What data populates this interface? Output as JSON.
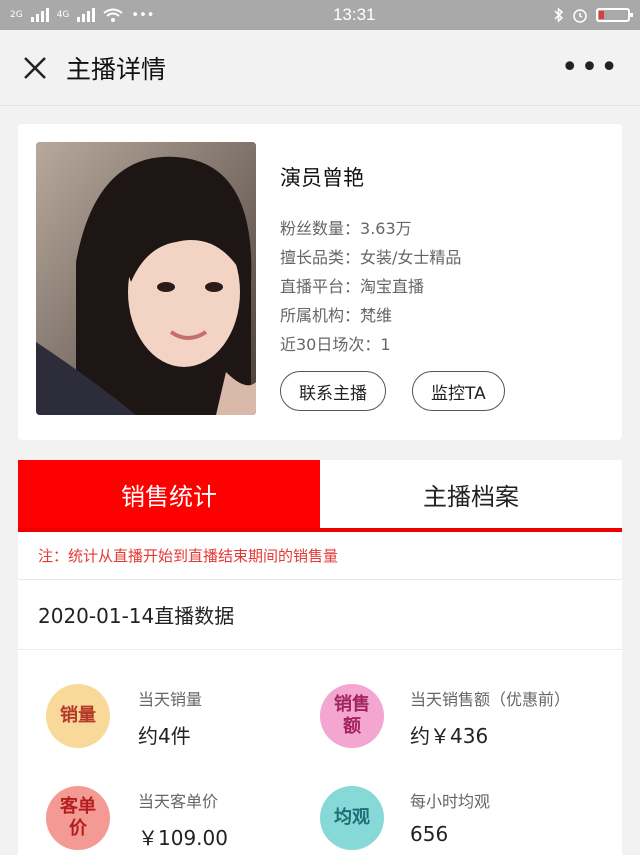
{
  "status": {
    "signal1": "2G",
    "signal2": "4G",
    "more": "•••",
    "time": "13:31"
  },
  "nav": {
    "title": "主播详情",
    "more": "•••"
  },
  "anchor": {
    "name": "演员曾艳",
    "fields": [
      {
        "label": "粉丝数量：",
        "value": "3.63万"
      },
      {
        "label": "擅长品类：",
        "value": "女装/女士精品"
      },
      {
        "label": "直播平台：",
        "value": "淘宝直播"
      },
      {
        "label": "所属机构：",
        "value": "梵维"
      },
      {
        "label": "近30日场次：",
        "value": "1"
      }
    ],
    "contact_btn": "联系主播",
    "monitor_btn": "监控TA"
  },
  "tabs": {
    "sales": "销售统计",
    "profile": "主播档案"
  },
  "note": "注：统计从直播开始到直播结束期间的销售量",
  "date_title": "2020-01-14直播数据",
  "stats": [
    {
      "icon": "销量",
      "label": "当天销量",
      "value": "约4件",
      "bg": "#f9d99a",
      "fg": "#b33a28"
    },
    {
      "icon": "销售额",
      "label": "当天销售额（优惠前）",
      "value": "约￥436",
      "bg": "#f3a6d0",
      "fg": "#a2245c"
    },
    {
      "icon": "客单价",
      "label": "当天客单价",
      "value": "￥109.00",
      "bg": "#f49a95",
      "fg": "#b41e1e"
    },
    {
      "icon": "均观",
      "label": "每小时均观",
      "value": "656",
      "bg": "#86d9d6",
      "fg": "#1d6f74"
    }
  ],
  "colors": {
    "accent": "#ff0000",
    "note": "#e53935"
  }
}
